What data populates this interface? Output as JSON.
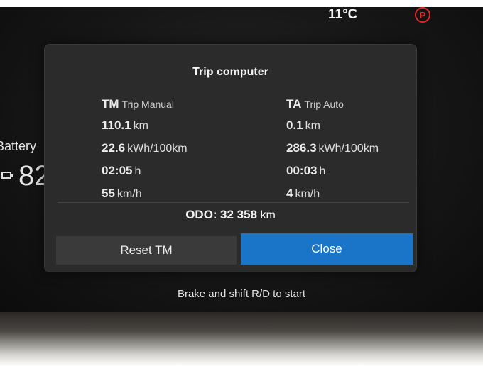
{
  "status": {
    "temperature": "11°C",
    "parking_brake_symbol": "P"
  },
  "left_panel": {
    "battery_label": "Battery",
    "battery_value": "82"
  },
  "dialog": {
    "title": "Trip computer",
    "trip_manual": {
      "code": "TM",
      "name": "Trip Manual",
      "distance": {
        "value": "110.1",
        "unit": "km"
      },
      "consumption": {
        "value": "22.6",
        "unit": "kWh/100km"
      },
      "time": {
        "value": "02:05",
        "unit": "h"
      },
      "avg_speed": {
        "value": "55",
        "unit": "km/h"
      }
    },
    "trip_auto": {
      "code": "TA",
      "name": "Trip Auto",
      "distance": {
        "value": "0.1",
        "unit": "km"
      },
      "consumption": {
        "value": "286.3",
        "unit": "kWh/100km"
      },
      "time": {
        "value": "00:03",
        "unit": "h"
      },
      "avg_speed": {
        "value": "4",
        "unit": "km/h"
      }
    },
    "odometer": {
      "label": "ODO:",
      "value": "32 358",
      "unit": "km"
    },
    "buttons": {
      "reset": "Reset TM",
      "close": "Close"
    }
  },
  "hint": "Brake and shift R/D to start",
  "colors": {
    "accent": "#1a74c8",
    "dialog_bg": "#2b2b2b",
    "warning_red": "#e02a2a"
  }
}
